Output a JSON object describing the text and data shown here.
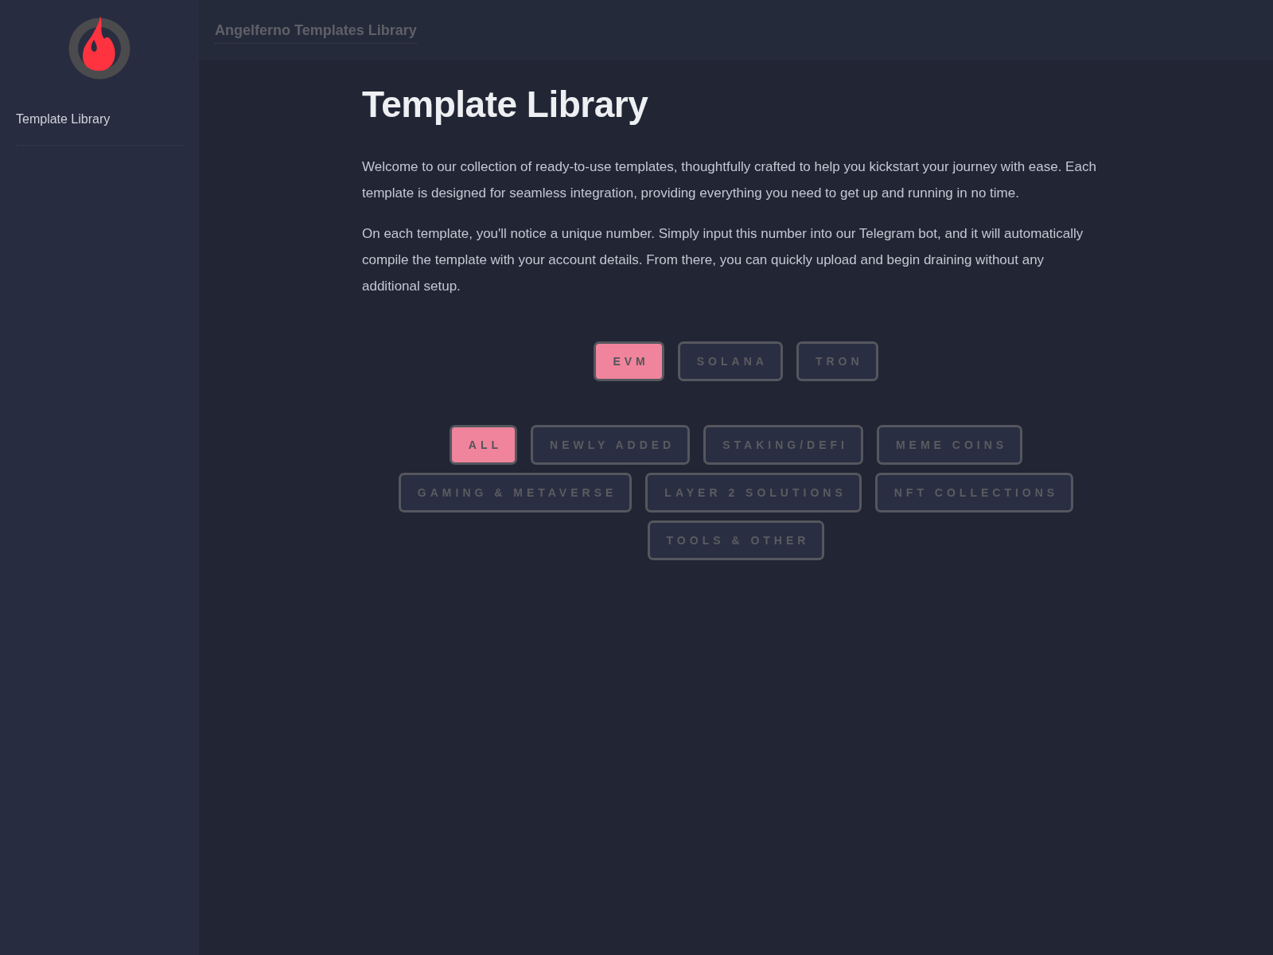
{
  "sidebar": {
    "items": [
      {
        "label": "Template Library"
      }
    ]
  },
  "header": {
    "title": "Angelferno Templates Library"
  },
  "page": {
    "title": "Template Library",
    "paragraphs": [
      "Welcome to our collection of ready-to-use templates, thoughtfully crafted to help you kickstart your journey with ease. Each template is designed for seamless integration, providing everything you need to get up and running in no time.",
      "On each template, you'll notice a unique number. Simply input this number into our Telegram bot, and it will automatically compile the template with your account details. From there, you can quickly upload and begin draining without any additional setup."
    ]
  },
  "chain_tabs": [
    {
      "label": "EVM",
      "selected": true
    },
    {
      "label": "SOLANA",
      "selected": false
    },
    {
      "label": "TRON",
      "selected": false
    }
  ],
  "category_filters": [
    {
      "label": "ALL",
      "selected": true
    },
    {
      "label": "NEWLY ADDED",
      "selected": false
    },
    {
      "label": "STAKING/DEFI",
      "selected": false
    },
    {
      "label": "MEME COINS",
      "selected": false
    },
    {
      "label": "GAMING & METAVERSE",
      "selected": false
    },
    {
      "label": "LAYER 2 SOLUTIONS",
      "selected": false
    },
    {
      "label": "NFT COLLECTIONS",
      "selected": false
    },
    {
      "label": "TOOLS & OTHER",
      "selected": false
    }
  ]
}
